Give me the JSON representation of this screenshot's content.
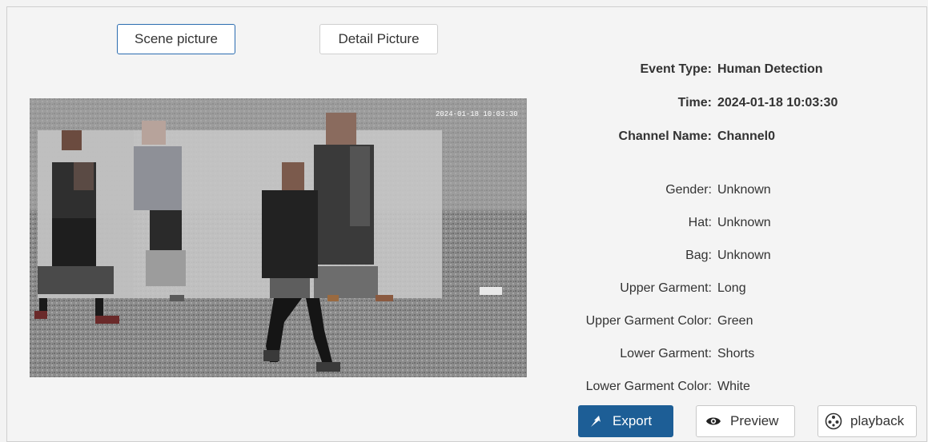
{
  "tabs": {
    "scene": "Scene picture",
    "detail": "Detail Picture"
  },
  "photo": {
    "timestamp": "2024-01-18 10:03:30"
  },
  "event": {
    "type_label": "Event Type:",
    "type_value": "Human Detection",
    "time_label": "Time:",
    "time_value": "2024-01-18 10:03:30",
    "channel_label": "Channel Name:",
    "channel_value": "Channel0"
  },
  "attributes": [
    {
      "label": "Gender:",
      "value": "Unknown"
    },
    {
      "label": "Hat:",
      "value": "Unknown"
    },
    {
      "label": "Bag:",
      "value": "Unknown"
    },
    {
      "label": "Upper Garment:",
      "value": "Long"
    },
    {
      "label": "Upper Garment Color:",
      "value": "Green"
    },
    {
      "label": "Lower Garment:",
      "value": "Shorts"
    },
    {
      "label": "Lower Garment Color:",
      "value": "White"
    }
  ],
  "actions": {
    "export": "Export",
    "preview": "Preview",
    "playback": "playback"
  },
  "colors": {
    "accent": "#1d5e96",
    "active_tab_border": "#2b6cb0"
  },
  "icons": {
    "export": "export-icon",
    "preview": "eye-icon",
    "playback": "playback-icon"
  }
}
